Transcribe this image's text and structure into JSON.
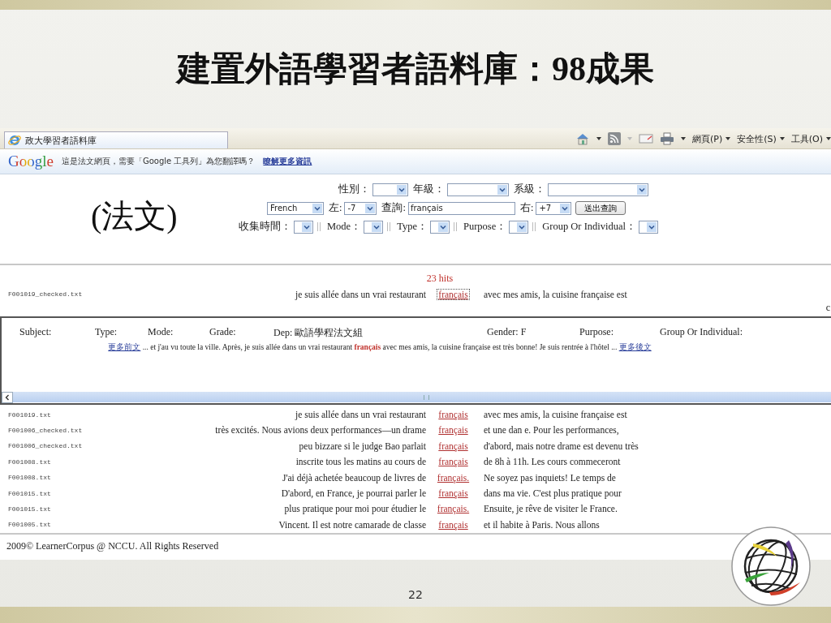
{
  "slide": {
    "title": "建置外語學習者語料庫：98成果",
    "annotation": "(法文)",
    "page_number": "22"
  },
  "browser": {
    "tab_title": "政大學習者語料庫",
    "menus": [
      "網頁(P)",
      "安全性(S)",
      "工具(O)"
    ]
  },
  "google_bar": {
    "logo": "Google",
    "message": "這是法文網頁，需要「Google 工具列」為您翻譯嗎？",
    "link": "瞭解更多資訊"
  },
  "form": {
    "rows": [
      {
        "items": [
          {
            "kind": "label",
            "text": "性別："
          },
          {
            "kind": "select"
          },
          {
            "kind": "label",
            "text": "年級："
          },
          {
            "kind": "select"
          },
          {
            "kind": "label",
            "text": "系級："
          },
          {
            "kind": "select"
          }
        ]
      },
      {
        "items": [
          {
            "kind": "select",
            "value": "French"
          },
          {
            "kind": "label",
            "text": "左:"
          },
          {
            "kind": "select",
            "value": "-7"
          },
          {
            "kind": "label",
            "text": "查詢:"
          },
          {
            "kind": "input",
            "value": "français"
          },
          {
            "kind": "label",
            "text": "右:"
          },
          {
            "kind": "select",
            "value": "+7"
          },
          {
            "kind": "button",
            "text": "送出查詢"
          }
        ]
      },
      {
        "items": [
          {
            "kind": "label",
            "text": "收集時間："
          },
          {
            "kind": "select"
          },
          {
            "kind": "separator"
          },
          {
            "kind": "label",
            "text": "Mode："
          },
          {
            "kind": "select"
          },
          {
            "kind": "separator"
          },
          {
            "kind": "label",
            "text": "Type："
          },
          {
            "kind": "select"
          },
          {
            "kind": "separator"
          },
          {
            "kind": "label",
            "text": "Purpose："
          },
          {
            "kind": "select"
          },
          {
            "kind": "separator"
          },
          {
            "kind": "label",
            "text": "Group Or Individual："
          },
          {
            "kind": "select"
          }
        ]
      }
    ]
  },
  "results": {
    "hits": "23 hits",
    "current": {
      "file": "F001019_checked.txt",
      "left": "je suis allée dans un vrai restaurant",
      "keyword": "français",
      "right": "avec mes amis, la cuisine française est",
      "selected": true
    },
    "cut_text": "c",
    "detail": {
      "fields": [
        "Subject:",
        "Type:",
        "Mode:",
        "Grade:",
        "Dep: 歐語學程法文組",
        "Gender: F",
        "Purpose:",
        "Group Or Individual:"
      ],
      "prev_link": "更多前文",
      "before": "... et j'au vu toute la ville. Après, je suis allée dans un vrai restaurant",
      "keyword": "français",
      "after": "avec mes amis, la cuisine française est très bonne! Je suis rentrée à l'hôtel ...",
      "next_link": "更多後文"
    },
    "rows": [
      {
        "file": "F001019.txt",
        "left": "je suis allée dans un vrai restaurant",
        "keyword": "français",
        "right": "avec mes amis, la cuisine française est",
        "selected": false
      },
      {
        "file": "F001006_checked.txt",
        "left": "très excités. Nous avions deux performances—un drame",
        "keyword": "français",
        "right": "et une dan e. Pour les performances,",
        "selected": false
      },
      {
        "file": "F001006_checked.txt",
        "left": "peu bizzare si le judge Bao parlait",
        "keyword": "français",
        "right": "d'abord, mais notre drame est devenu très",
        "selected": false
      },
      {
        "file": "F001008.txt",
        "left": "inscrite tous les matins au cours de",
        "keyword": "français",
        "right": "de 8h à 11h. Les cours commeceront",
        "selected": false
      },
      {
        "file": "F001008.txt",
        "left": "J'ai déjà achetée beaucoup de livres de",
        "keyword": "français.",
        "right": "Ne soyez pas inquiets! Le temps de",
        "selected": false
      },
      {
        "file": "F001015.txt",
        "left": "D'abord, en France, je pourrai parler le",
        "keyword": "français",
        "right": "dans ma vie. C'est plus pratique pour",
        "selected": false
      },
      {
        "file": "F001015.txt",
        "left": "plus pratique pour moi pour étudier le",
        "keyword": "français.",
        "right": "Ensuite, je rêve de visiter le France.",
        "selected": false
      },
      {
        "file": "F001005.txt",
        "left": "Vincent. Il est notre camarade de classe",
        "keyword": "français",
        "right": "et il habite à Paris. Nous allons",
        "selected": false
      }
    ]
  },
  "footer": "2009© LearnerCorpus @ NCCU. All Rights Reserved"
}
